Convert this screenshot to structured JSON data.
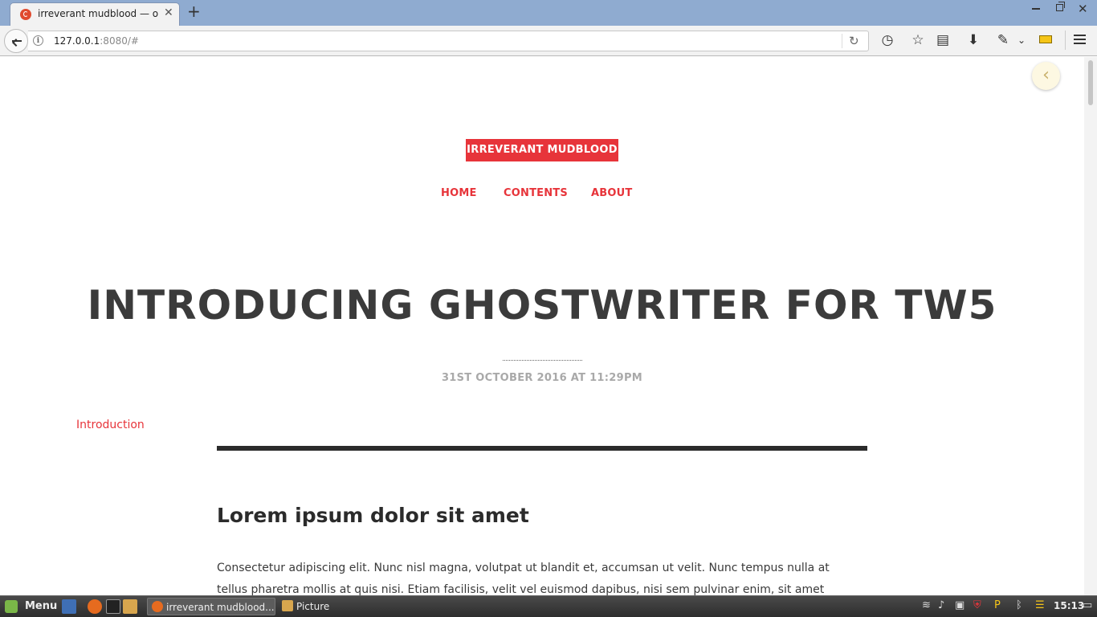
{
  "browser": {
    "tab_title": "irreverant mudblood — o…",
    "url_host": "127.0.0.1",
    "url_rest": ":8080/#",
    "icons": [
      "back-icon",
      "info-icon",
      "reload-icon",
      "history-icon",
      "bookmark-star-icon",
      "reading-list-icon",
      "download-icon",
      "tools-icon",
      "chevron-down-icon",
      "ruler-icon",
      "hamburger-menu-icon"
    ]
  },
  "site": {
    "title": "IRREVERANT MUDBLOOD",
    "nav": [
      "HOME",
      "CONTENTS",
      "ABOUT"
    ]
  },
  "post": {
    "title": "INTRODUCING GHOSTWRITER FOR TW5",
    "date": "31ST OCTOBER 2016 AT 11:29PM",
    "toc_link": "Introduction",
    "section_heading": "Lorem ipsum dolor sit amet",
    "paragraph": "Consectetur adipiscing elit. Nunc nisl magna, volutpat ut blandit et, accumsan ut velit. Nunc tempus nulla at tellus pharetra mollis at quis nisi. Etiam facilisis, velit vel euismod dapibus, nisi sem pulvinar enim, sit amet sagittis orci"
  },
  "taskbar": {
    "menu_label": "Menu",
    "tasks": [
      {
        "label": "irreverant mudblood...",
        "active": true
      },
      {
        "label": "Picture",
        "active": false
      }
    ],
    "clock": "15:13"
  },
  "colors": {
    "accent": "#e7343a",
    "title_text": "#3b3b3b",
    "date_text": "#a9a9a9"
  }
}
